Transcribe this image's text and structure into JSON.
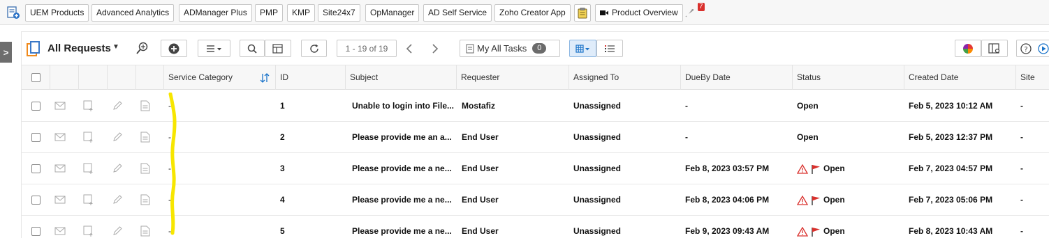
{
  "bookmarks": [
    {
      "label": "UEM Products"
    },
    {
      "label": "Advanced Analytics"
    },
    {
      "label": "ADManager Plus"
    },
    {
      "label": "PMP"
    },
    {
      "label": "KMP"
    },
    {
      "label": "Site24x7"
    },
    {
      "label": "OpManager"
    },
    {
      "label": "AD Self Service"
    },
    {
      "label": "Zoho Creator App"
    }
  ],
  "product_overview": {
    "label": "Product Overview",
    "badge": "7"
  },
  "toolbar": {
    "title": "All Requests",
    "pager": "1 - 19 of 19",
    "my_tasks_label": "My All Tasks",
    "my_tasks_count": "0"
  },
  "table": {
    "columns": [
      "Service Category",
      "ID",
      "Subject",
      "Requester",
      "Assigned To",
      "DueBy Date",
      "Status",
      "Created Date",
      "Site"
    ],
    "rows": [
      {
        "service_category": "-",
        "id": "1",
        "subject": "Unable to login into File...",
        "requester": "Mostafiz",
        "assigned_to": "Unassigned",
        "due_by": "-",
        "status": "Open",
        "overdue": false,
        "created": "Feb 5, 2023 10:12 AM",
        "site": "-"
      },
      {
        "service_category": "-",
        "id": "2",
        "subject": "Please provide me an a...",
        "requester": "End User",
        "assigned_to": "Unassigned",
        "due_by": "-",
        "status": "Open",
        "overdue": false,
        "created": "Feb 5, 2023 12:37 PM",
        "site": "-"
      },
      {
        "service_category": "-",
        "id": "3",
        "subject": "Please provide me a ne...",
        "requester": "End User",
        "assigned_to": "Unassigned",
        "due_by": "Feb 8, 2023 03:57 PM",
        "status": "Open",
        "overdue": true,
        "created": "Feb 7, 2023 04:57 PM",
        "site": "-"
      },
      {
        "service_category": "-",
        "id": "4",
        "subject": "Please provide me a ne...",
        "requester": "End User",
        "assigned_to": "Unassigned",
        "due_by": "Feb 8, 2023 04:06 PM",
        "status": "Open",
        "overdue": true,
        "created": "Feb 7, 2023 05:06 PM",
        "site": "-"
      },
      {
        "service_category": "-",
        "id": "5",
        "subject": "Please provide me a ne...",
        "requester": "End User",
        "assigned_to": "Unassigned",
        "due_by": "Feb 9, 2023 09:43 AM",
        "status": "Open",
        "overdue": true,
        "created": "Feb 8, 2023 10:43 AM",
        "site": "-"
      }
    ]
  },
  "colors": {
    "accent": "#1a73c9",
    "warning": "#d9302c",
    "highlight": "#f7e600"
  }
}
